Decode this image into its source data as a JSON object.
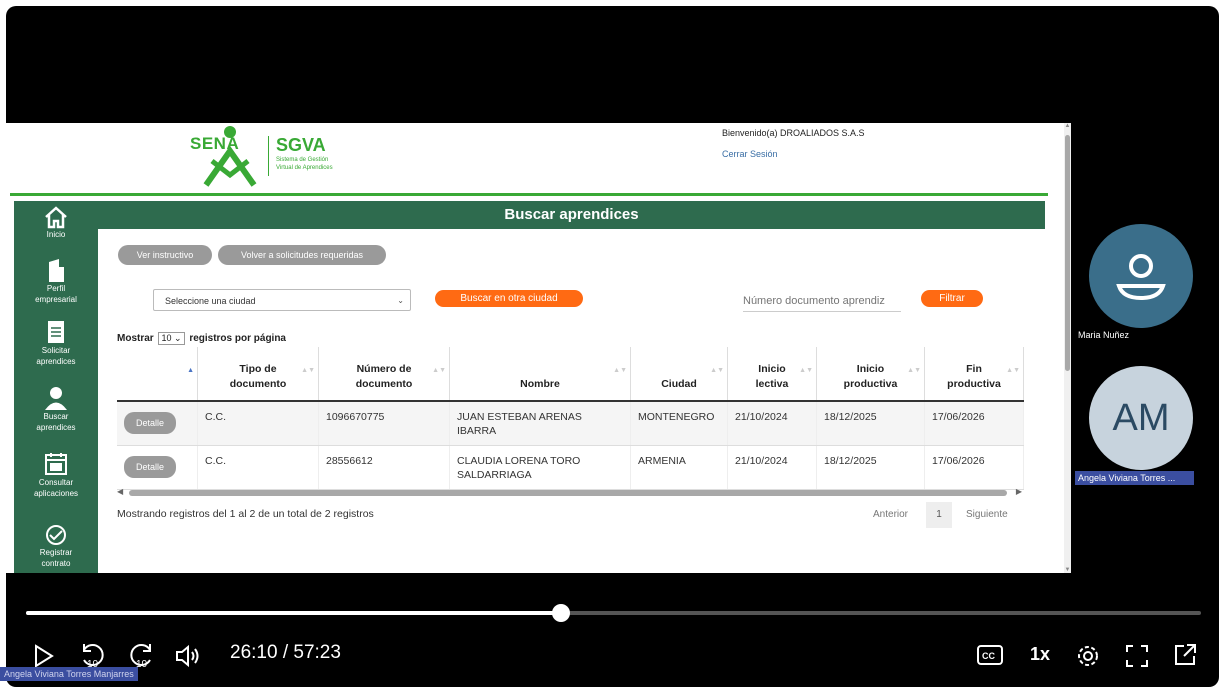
{
  "sgva": {
    "brand_word": "SENA",
    "app_name": "SGVA",
    "app_subtitle_1": "Sistema de Gestión",
    "app_subtitle_2": "Virtual de Aprendices",
    "welcome": "Bienvenido(a) DROALIADOS S.A.S",
    "logout": "Cerrar Sesión",
    "page_title": "Buscar aprendices",
    "sidebar": [
      {
        "label1": "Inicio",
        "label2": ""
      },
      {
        "label1": "Perfil",
        "label2": "empresarial"
      },
      {
        "label1": "Solicitar",
        "label2": "aprendices"
      },
      {
        "label1": "Buscar",
        "label2": "aprendices"
      },
      {
        "label1": "Consultar",
        "label2": "aplicaciones"
      },
      {
        "label1": "Registrar",
        "label2": "contrato"
      }
    ],
    "buttons": {
      "instructions": "Ver instructivo",
      "back": "Volver a solicitudes requeridas",
      "other_city": "Buscar en otra ciudad",
      "filter": "Filtrar"
    },
    "city_select": "Seleccione una ciudad",
    "doc_placeholder": "Número documento aprendiz",
    "show_prefix": "Mostrar",
    "page_size": "10",
    "show_suffix": "registros por página",
    "columns": [
      {
        "l1": "",
        "l2": ""
      },
      {
        "l1": "Tipo de",
        "l2": "documento"
      },
      {
        "l1": "Número de",
        "l2": "documento"
      },
      {
        "l1": "",
        "l2": "Nombre"
      },
      {
        "l1": "",
        "l2": "Ciudad"
      },
      {
        "l1": "Inicio",
        "l2": "lectiva"
      },
      {
        "l1": "Inicio",
        "l2": "productiva"
      },
      {
        "l1": "Fin",
        "l2": "productiva"
      }
    ],
    "rows": [
      {
        "action": "Detalle",
        "tipo": "C.C.",
        "numero": "1096670775",
        "nombre1": "JUAN ESTEBAN ARENAS",
        "nombre2": "IBARRA",
        "ciudad": "MONTENEGRO",
        "inicio_lectiva": "21/10/2024",
        "inicio_productiva": "18/12/2025",
        "fin_productiva": "17/06/2026"
      },
      {
        "action": "Detalle",
        "tipo": "C.C.",
        "numero": "28556612",
        "nombre1": "CLAUDIA LORENA TORO",
        "nombre2": "SALDARRIAGA",
        "ciudad": "ARMENIA",
        "inicio_lectiva": "21/10/2024",
        "inicio_productiva": "18/12/2025",
        "fin_productiva": "17/06/2026"
      }
    ],
    "showing": "Mostrando registros del 1 al 2 de un total de 2 registros",
    "pager": {
      "prev": "Anterior",
      "page": "1",
      "next": "Siguiente"
    }
  },
  "participants": [
    {
      "name": "Maria Nuñez",
      "initials": "",
      "color": "#3a6e8a"
    },
    {
      "name": "Angela Viviana Torres ...",
      "initials": "AM",
      "color": "#c7d3dd"
    }
  ],
  "player": {
    "progress": 0.455,
    "time": "26:10 / 57:23",
    "speed": "1x",
    "caption_name": "Angela Viviana Torres Manjarres",
    "icons": [
      "play-icon",
      "rewind-10-icon",
      "forward-10-icon",
      "volume-icon",
      "captions-icon",
      "settings-icon",
      "fullscreen-icon",
      "popout-icon"
    ]
  },
  "colors": {
    "sena_green": "#39a935",
    "sidebar_green": "#2e6b4e",
    "orange": "#ff6a13",
    "grey_button": "#9a9a9a"
  }
}
